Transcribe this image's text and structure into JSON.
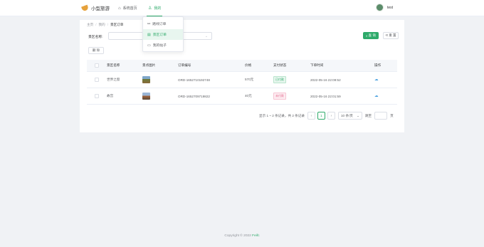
{
  "app": {
    "title": "小型旅游"
  },
  "nav": {
    "home_label": "系统首页",
    "mine_label": "我的"
  },
  "user": {
    "name": "test"
  },
  "dropdown": {
    "items": [
      {
        "label": "路线订单"
      },
      {
        "label": "景区订单"
      },
      {
        "label": "我的帖子"
      }
    ]
  },
  "breadcrumb": {
    "items": [
      "主页",
      "我的",
      "景区订单"
    ]
  },
  "search": {
    "label": "景区名称:",
    "placeholder": "",
    "query_label": "查 询",
    "reset_label": "重 置"
  },
  "toolbar": {
    "delete_label": "删 除"
  },
  "table": {
    "headers": [
      "景区名称",
      "景点图片",
      "订单编号",
      "价格",
      "支付状态",
      "下单时间",
      "操作"
    ],
    "rows": [
      {
        "name": "世界之窗",
        "order_no": "ORD-1652710192748",
        "price": "570元",
        "pay_status": "已付款",
        "time": "2022-05-16 22:09:52"
      },
      {
        "name": "故宫",
        "order_no": "ORD-1652709719822",
        "price": "40元",
        "pay_status": "未付款",
        "time": "2022-05-16 22:01:59"
      }
    ]
  },
  "pagination": {
    "total_text": "显示 1 ~ 2 条记录，共 2 条记录",
    "current_page": "1",
    "page_size": "10 条/页",
    "jump_label": "跳至",
    "page_suffix": "页"
  },
  "footer": {
    "copyright": "Copyright © 2022",
    "brand": "Feifc"
  },
  "colors": {
    "accent": "#2eaa6a",
    "paid": "#2eaa6a",
    "unpaid": "#e26a8d",
    "link": "#4ea3e0"
  }
}
